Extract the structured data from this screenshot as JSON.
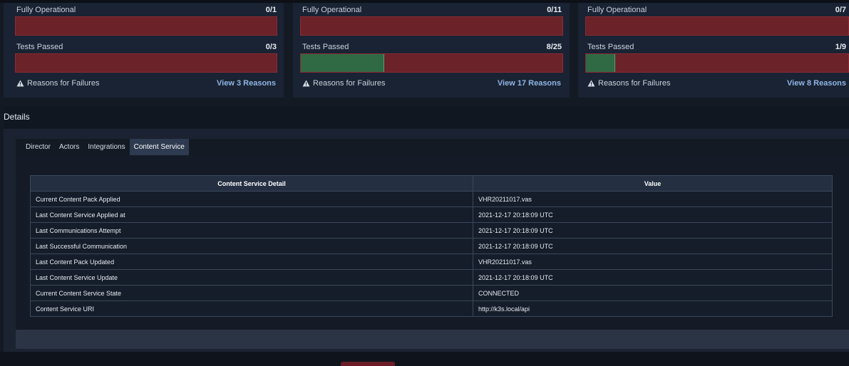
{
  "cards": [
    {
      "fully_operational_label": "Fully Operational",
      "fully_operational_value": "0/1",
      "fully_operational_fraction": 0,
      "tests_passed_label": "Tests Passed",
      "tests_passed_value": "0/3",
      "tests_passed_fraction": 0,
      "reasons_label": "Reasons for Failures",
      "view_label": "View 3 Reasons"
    },
    {
      "fully_operational_label": "Fully Operational",
      "fully_operational_value": "0/11",
      "fully_operational_fraction": 0,
      "tests_passed_label": "Tests Passed",
      "tests_passed_value": "8/25",
      "tests_passed_fraction": 0.32,
      "reasons_label": "Reasons for Failures",
      "view_label": "View 17 Reasons"
    },
    {
      "fully_operational_label": "Fully Operational",
      "fully_operational_value": "0/7",
      "fully_operational_fraction": 0,
      "tests_passed_label": "Tests Passed",
      "tests_passed_value": "1/9",
      "tests_passed_fraction": 0.111,
      "reasons_label": "Reasons for Failures",
      "view_label": "View 8 Reasons"
    }
  ],
  "details": {
    "title": "Details",
    "tabs": [
      "Director",
      "Actors",
      "Integrations",
      "Content Service"
    ],
    "active_tab": "Content Service",
    "table": {
      "columns": [
        "Content Service Detail",
        "Value"
      ],
      "rows": [
        [
          "Current Content Pack Applied",
          "VHR20211017.vas"
        ],
        [
          "Last Content Service Applied at",
          "2021-12-17 20:18:09 UTC"
        ],
        [
          "Last Communications Attempt",
          "2021-12-17 20:18:09 UTC"
        ],
        [
          "Last Successful Communication",
          "2021-12-17 20:18:09 UTC"
        ],
        [
          "Last Content Pack Updated",
          "VHR20211017.vas"
        ],
        [
          "Last Content Service Update",
          "2021-12-17 20:18:09 UTC"
        ],
        [
          "Current Content Service State",
          "CONNECTED"
        ],
        [
          "Content Service URI",
          "http://k3s.local/api"
        ]
      ]
    }
  },
  "colors": {
    "bar_fail": "#6b2229",
    "bar_pass": "#2f6a44",
    "link": "#8fb5e6",
    "background": "#141a24"
  },
  "icons": {
    "reasons": "warning-triangle-icon"
  }
}
